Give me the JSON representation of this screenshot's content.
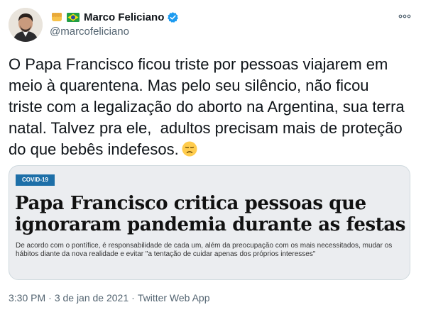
{
  "user": {
    "display_name": "Marco Feliciano",
    "handle": "@marcofeliciano"
  },
  "icons": {
    "fist": "raised-fist-emoji",
    "flag": "brazil-flag-emoji",
    "verified": "verified-badge-icon",
    "more": "more-options-icon",
    "sad": "disappointed-face-emoji"
  },
  "tweet": {
    "text": "O Papa Francisco ficou triste por pessoas viajarem em meio à quarentena. Mas pelo seu silêncio, não ficou triste com a legalização do aborto na Argentina, sua terra natal. Talvez pra ele,  adultos precisam mais de proteção do que bebês indefesos."
  },
  "card": {
    "badge": "COVID-19",
    "headline": "Papa Francisco critica pessoas que ignoraram pandemia durante as festas",
    "subtext": "De acordo com o pontífice, é responsabilidade de cada um, além da preocupação com os mais necessitados, mudar os hábitos diante da nova realidade e evitar \"a tentação de cuidar apenas dos próprios interesses\""
  },
  "meta": {
    "time": "3:30 PM",
    "separator": "·",
    "date": "3 de jan de 2021",
    "separator2": "·",
    "source": "Twitter Web App"
  },
  "colors": {
    "verified_blue": "#1d9bf0",
    "badge_blue": "#1d6fa8",
    "secondary_text": "#536471"
  }
}
